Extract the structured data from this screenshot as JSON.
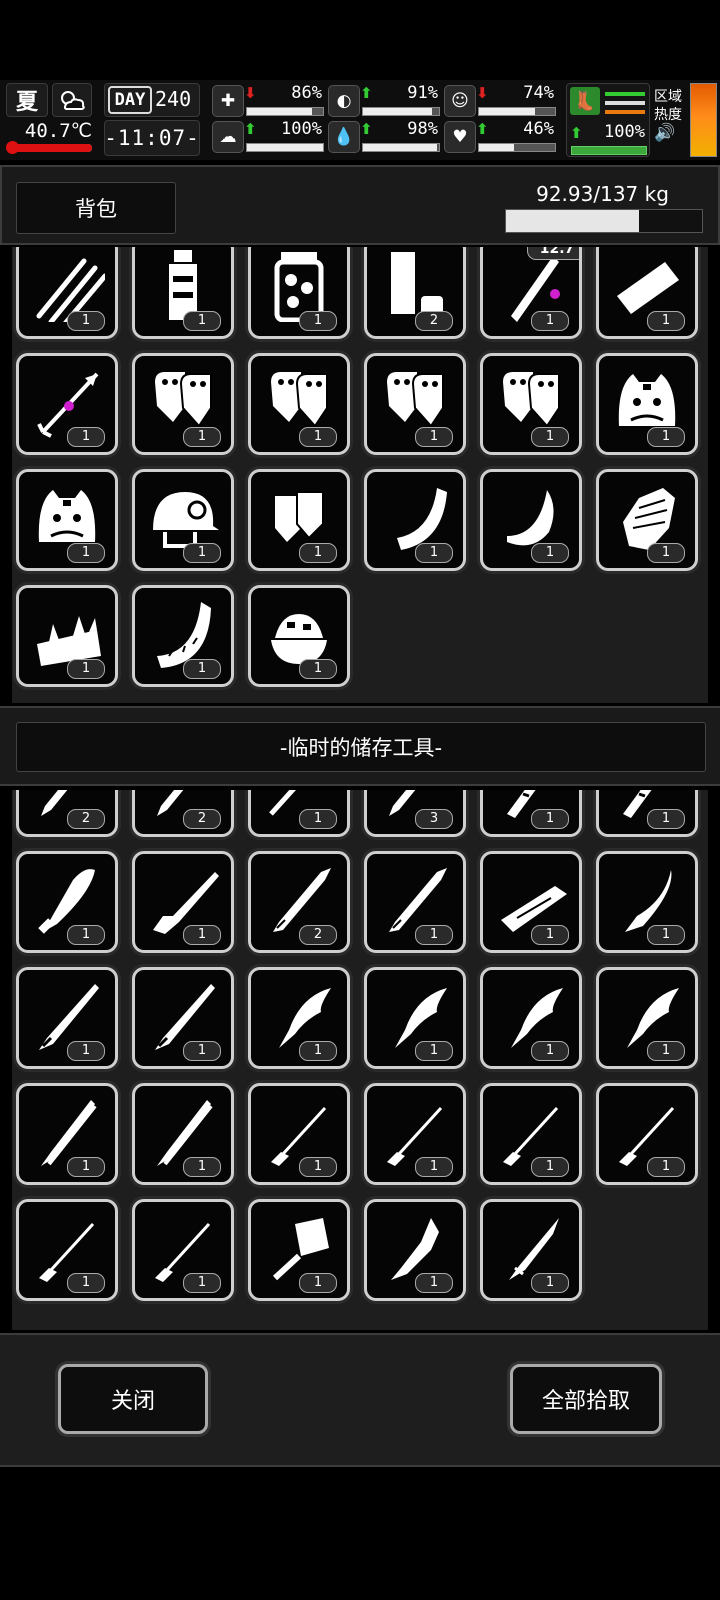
{
  "hud": {
    "season": "夏",
    "temperature": "40.7℃",
    "day_label": "DAY",
    "day": "240",
    "time": "-11:07-",
    "stats_top": [
      {
        "icon": "medkit-icon",
        "glyph": "✚",
        "dir": "down",
        "value": "86%",
        "level": 0.86
      },
      {
        "icon": "stomach-icon",
        "glyph": "◐",
        "dir": "up",
        "value": "91%",
        "level": 0.91
      },
      {
        "icon": "mood-icon",
        "glyph": "☺",
        "dir": "down",
        "value": "74%",
        "level": 0.74
      }
    ],
    "stats_bottom": [
      {
        "icon": "brain-icon",
        "glyph": "☁",
        "dir": "up",
        "value": "100%",
        "level": 1.0
      },
      {
        "icon": "water-drop-icon",
        "glyph": "💧",
        "dir": "up",
        "value": "98%",
        "level": 0.98
      },
      {
        "icon": "heart-icon",
        "glyph": "♥",
        "dir": "up",
        "value": "46%",
        "level": 0.46
      }
    ],
    "stamina": {
      "value": "100%",
      "level": 1.0
    },
    "region_label": "区域\n热度",
    "colors": {
      "up": "#33cc33",
      "down": "#dd2222",
      "heat": "#ff7a10"
    }
  },
  "backpack": {
    "title": "背包",
    "weight": "92.93/137 kg",
    "weight_fraction": 0.678,
    "items": [
      {
        "icon": "claw-marks-icon",
        "count": "1"
      },
      {
        "icon": "bottle-icon",
        "count": "1"
      },
      {
        "icon": "pickle-jar-icon",
        "count": "1"
      },
      {
        "icon": "shotgun-shells-icon",
        "count": "2"
      },
      {
        "icon": "rifle-bullet-icon",
        "count": "1",
        "tag": "12.7"
      },
      {
        "icon": "bullet-casing-icon",
        "count": "1"
      },
      {
        "icon": "arrow-icon",
        "count": "1"
      },
      {
        "icon": "gloves-icon",
        "count": "1"
      },
      {
        "icon": "gloves-icon",
        "count": "1"
      },
      {
        "icon": "gloves-icon",
        "count": "1"
      },
      {
        "icon": "gloves-icon",
        "count": "1"
      },
      {
        "icon": "tiger-hat-icon",
        "count": "1"
      },
      {
        "icon": "tiger-hat-icon",
        "count": "1"
      },
      {
        "icon": "helmet-icon",
        "count": "1"
      },
      {
        "icon": "fingerless-gloves-icon",
        "count": "1"
      },
      {
        "icon": "meat-slice-icon",
        "count": "1"
      },
      {
        "icon": "melon-rind-icon",
        "count": "1"
      },
      {
        "icon": "gauntlet-icon",
        "count": "1"
      },
      {
        "icon": "spiked-meat-icon",
        "count": "1"
      },
      {
        "icon": "rind-slice-icon",
        "count": "1"
      },
      {
        "icon": "food-bowl-icon",
        "count": "1"
      }
    ]
  },
  "storage": {
    "title": "-临时的储存工具-",
    "items": [
      {
        "icon": "blade-icon",
        "count": "2"
      },
      {
        "icon": "blade-icon",
        "count": "2"
      },
      {
        "icon": "ladle-icon",
        "count": "1"
      },
      {
        "icon": "blade-icon",
        "count": "3"
      },
      {
        "icon": "serrated-blade-icon",
        "count": "1"
      },
      {
        "icon": "serrated-blade-icon",
        "count": "1"
      },
      {
        "icon": "wide-knife-icon",
        "count": "1"
      },
      {
        "icon": "rifle-icon",
        "count": "1"
      },
      {
        "icon": "machete-icon",
        "count": "2"
      },
      {
        "icon": "machete-icon",
        "count": "1"
      },
      {
        "icon": "wooden-club-icon",
        "count": "1"
      },
      {
        "icon": "curved-knife-icon",
        "count": "1"
      },
      {
        "icon": "long-sword-icon",
        "count": "1"
      },
      {
        "icon": "long-sword-icon",
        "count": "1"
      },
      {
        "icon": "kukri-icon",
        "count": "1"
      },
      {
        "icon": "kukri-icon",
        "count": "1"
      },
      {
        "icon": "kukri-icon",
        "count": "1"
      },
      {
        "icon": "kukri-icon",
        "count": "1"
      },
      {
        "icon": "katana-icon",
        "count": "1"
      },
      {
        "icon": "katana-icon",
        "count": "1"
      },
      {
        "icon": "screwdriver-icon",
        "count": "1"
      },
      {
        "icon": "screwdriver-icon",
        "count": "1"
      },
      {
        "icon": "screwdriver-icon",
        "count": "1"
      },
      {
        "icon": "screwdriver-icon",
        "count": "1"
      },
      {
        "icon": "screwdriver-icon",
        "count": "1"
      },
      {
        "icon": "screwdriver-icon",
        "count": "1"
      },
      {
        "icon": "cleaver-icon",
        "count": "1"
      },
      {
        "icon": "broken-blade-icon",
        "count": "1"
      },
      {
        "icon": "dagger-icon",
        "count": "1"
      }
    ]
  },
  "buttons": {
    "close": "关闭",
    "pick_all": "全部拾取"
  }
}
